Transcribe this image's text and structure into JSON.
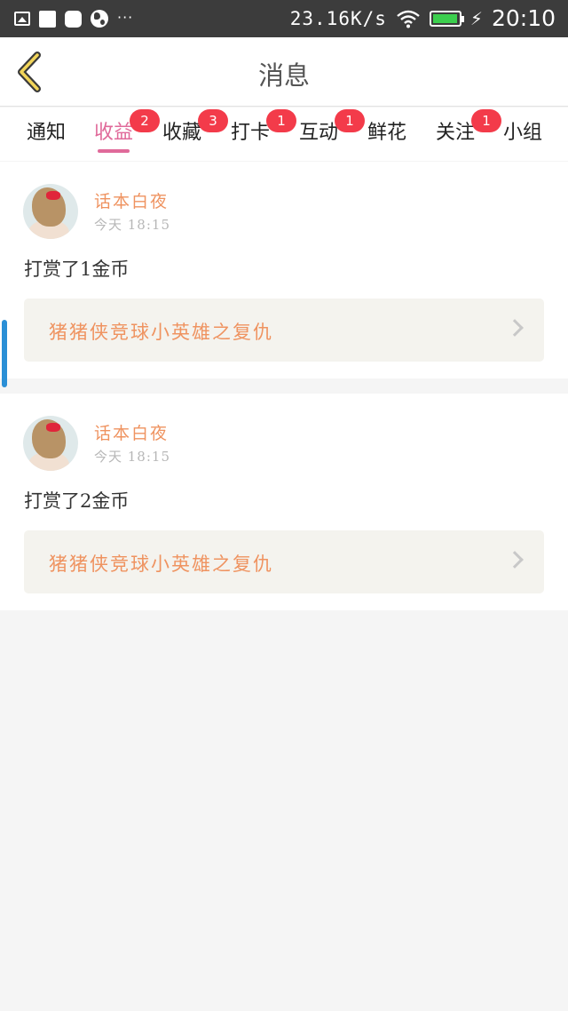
{
  "status_bar": {
    "net_speed": "23.16K/s",
    "time": "20:10",
    "dots": "···",
    "battery_level": 0.95
  },
  "header": {
    "title": "消息"
  },
  "tabs": [
    {
      "label": "通知",
      "badge": ""
    },
    {
      "label": "收益",
      "badge": "2"
    },
    {
      "label": "收藏",
      "badge": "3"
    },
    {
      "label": "打卡",
      "badge": "1"
    },
    {
      "label": "互动",
      "badge": "1"
    },
    {
      "label": "鲜花",
      "badge": ""
    },
    {
      "label": "关注",
      "badge": "1"
    },
    {
      "label": "小组",
      "badge": ""
    }
  ],
  "active_tab": "收益",
  "messages": [
    {
      "author": "话本白夜",
      "time": "今天  18:15",
      "text": "打赏了1金币",
      "book": "猪猪侠竞球小英雄之复仇"
    },
    {
      "author": "话本白夜",
      "time": "今天  18:15",
      "text": "打赏了2金币",
      "book": "猪猪侠竞球小英雄之复仇"
    }
  ],
  "colors": {
    "accent": "#e06a9a",
    "badge": "#f33b4a",
    "author": "#ef9360",
    "status_bar": "#3c3c3c"
  }
}
